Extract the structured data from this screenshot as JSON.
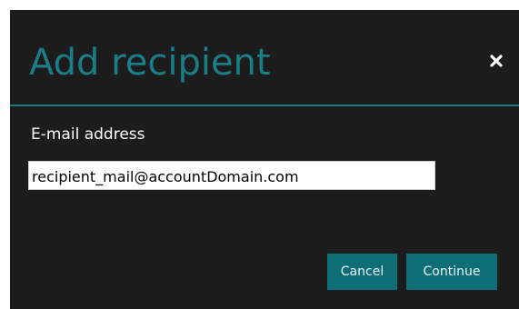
{
  "dialog": {
    "title": "Add recipient",
    "close_icon": "close-icon",
    "email_label": "E-mail address",
    "email_value": "recipient_mail@accountDomain.com",
    "cancel_label": "Cancel",
    "continue_label": "Continue"
  },
  "colors": {
    "background": "#1c1c1c",
    "accent": "#1a7d87",
    "button": "#0e6e78",
    "text": "#ffffff"
  }
}
